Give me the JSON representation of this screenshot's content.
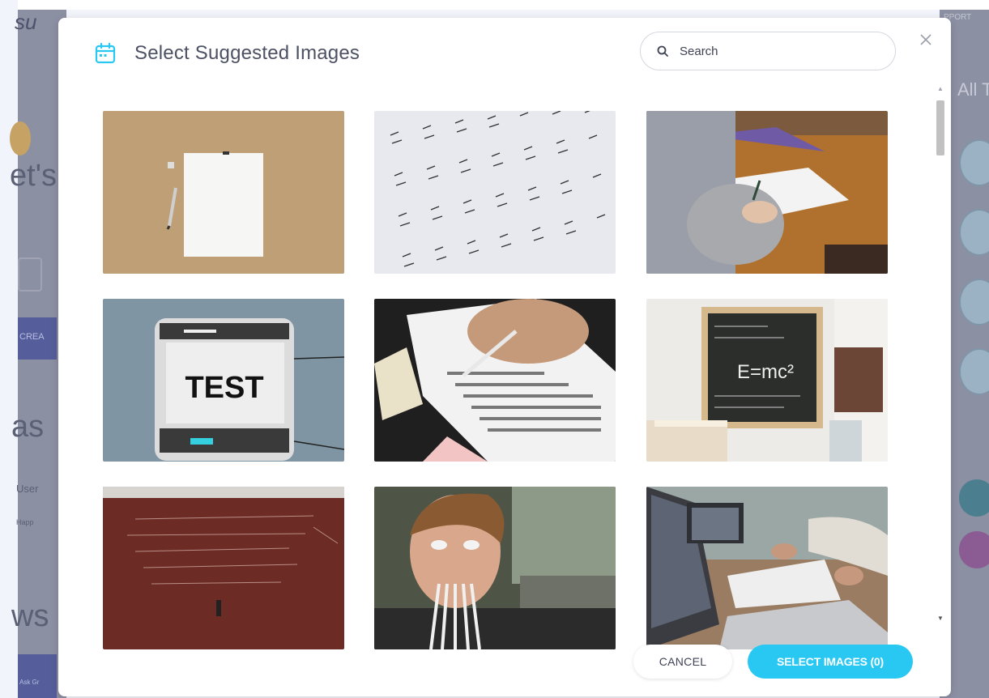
{
  "background": {
    "logo_fragment": "su",
    "heading_fragment_1": "et's",
    "heading_fragment_2": "as",
    "heading_fragment_3": "ws",
    "create_button_fragment": "CREA",
    "user_fragment": "User",
    "happ_fragment": "Happ",
    "footer_fragment": "Ask Gr",
    "support_fragment": "PPORT",
    "tab_fragment": "All T"
  },
  "modal": {
    "title": "Select Suggested Images",
    "title_icon": "calendar-icon",
    "search": {
      "placeholder": "Search",
      "value": ""
    },
    "close_icon": "close-icon",
    "images": [
      {
        "name": "image-paper-pencil"
      },
      {
        "name": "image-math-worksheet"
      },
      {
        "name": "image-student-writing"
      },
      {
        "name": "image-test-scanner",
        "text": "TEST"
      },
      {
        "name": "image-answer-sheet"
      },
      {
        "name": "image-chalkboard-emc2",
        "text": "E=mc²"
      },
      {
        "name": "image-red-chalkboard"
      },
      {
        "name": "image-boy-pencils"
      },
      {
        "name": "image-laptops-meeting"
      }
    ],
    "cancel_label": "CANCEL",
    "select_label": "SELECT IMAGES (0)"
  },
  "colors": {
    "accent": "#29c8f2",
    "title_text": "#4c5163",
    "overlay": "#8c90a3"
  }
}
